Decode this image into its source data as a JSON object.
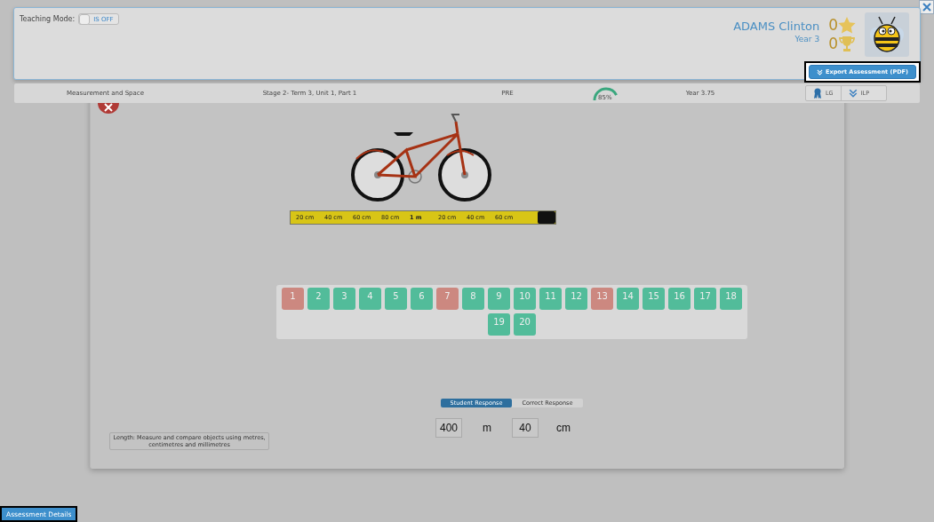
{
  "header": {
    "teaching_mode": {
      "label": "Teaching Mode:",
      "on": false,
      "state_text": "IS OFF"
    },
    "student": {
      "name": "ADAMS Clinton",
      "year": "Year 3"
    },
    "stars_count": "0",
    "trophies_count": "0",
    "export_button": "Export Assessment (PDF)"
  },
  "info_bar": {
    "strand": "Measurement and Space",
    "unit": "Stage 2- Term 3, Unit 1, Part 1",
    "phase": "PRE",
    "score": {
      "level": 0.85,
      "text": "85%"
    },
    "year": "Year 3.75",
    "buttons": [
      "LG",
      "ILP"
    ]
  },
  "tape_labels": [
    "20 cm",
    "40 cm",
    "60 cm",
    "80 cm",
    "1 m",
    "20 cm",
    "40 cm",
    "60 cm"
  ],
  "questions": [
    {
      "number": "1",
      "correct": false
    },
    {
      "number": "2",
      "correct": true
    },
    {
      "number": "3",
      "correct": true
    },
    {
      "number": "4",
      "correct": true
    },
    {
      "number": "5",
      "correct": true
    },
    {
      "number": "6",
      "correct": true
    },
    {
      "number": "7",
      "correct": false
    },
    {
      "number": "8",
      "correct": true
    },
    {
      "number": "9",
      "correct": true
    },
    {
      "number": "10",
      "correct": true
    },
    {
      "number": "11",
      "correct": true
    },
    {
      "number": "12",
      "correct": true
    },
    {
      "number": "13",
      "correct": false
    },
    {
      "number": "14",
      "correct": true
    },
    {
      "number": "15",
      "correct": true
    },
    {
      "number": "16",
      "correct": true
    },
    {
      "number": "17",
      "correct": true
    },
    {
      "number": "18",
      "correct": true
    },
    {
      "number": "19",
      "correct": true
    },
    {
      "number": "20",
      "correct": true
    }
  ],
  "response_tabs": [
    {
      "label": "Student Response",
      "selected": true
    },
    {
      "label": "Correct Response",
      "selected": false
    }
  ],
  "answer": [
    {
      "value": "400",
      "unit": "m"
    },
    {
      "value": "40",
      "unit": "cm"
    }
  ],
  "objective": "Length: Measure and compare objects using metres, centimetres and millimetres",
  "footer_button": "Assessment Details"
}
